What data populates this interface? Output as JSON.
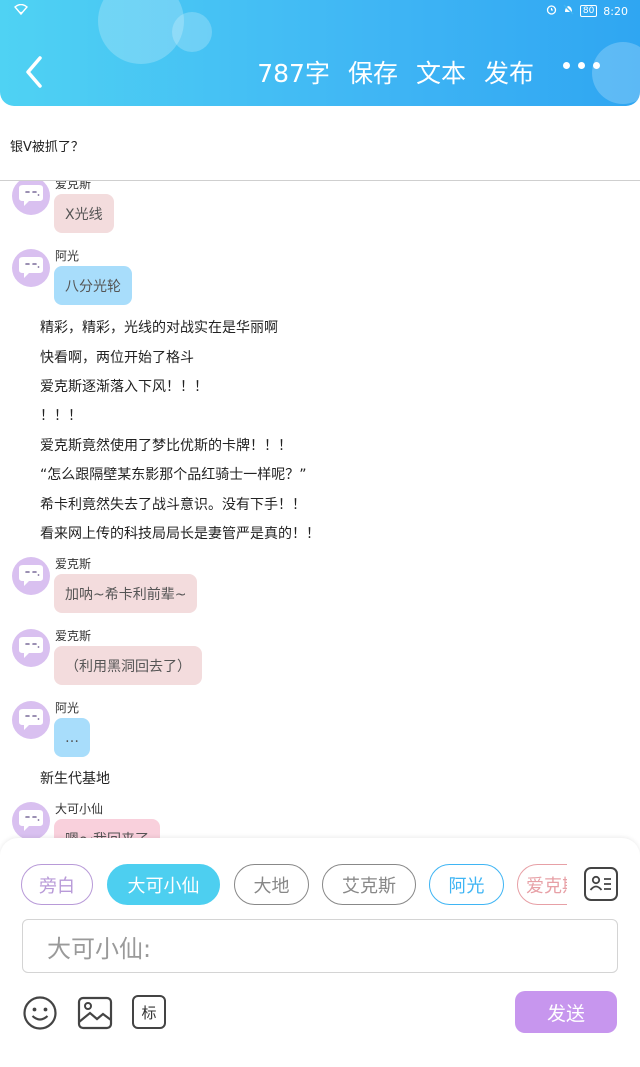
{
  "status_bar": {
    "wifi": "wifi-icon",
    "alarm": "alarm-icon",
    "mute": "mute-icon",
    "battery": "80",
    "time": "8:20"
  },
  "header": {
    "back": "back-chevron-icon",
    "word_count": "787字",
    "save": "保存",
    "text": "文本",
    "publish": "发布",
    "more": "more-dots-icon"
  },
  "title": "银V被抓了？",
  "messages": [
    {
      "type": "bubble",
      "name": "爱克斯",
      "text": "X光线",
      "color": "#f3dcdd"
    },
    {
      "type": "bubble",
      "name": "阿光",
      "text": "八分光轮",
      "color": "#a8ddfb"
    },
    {
      "type": "narration",
      "text": "精彩，精彩，光线的对战实在是华丽啊"
    },
    {
      "type": "narration",
      "text": "快看啊，两位开始了格斗"
    },
    {
      "type": "narration",
      "text": "爱克斯逐渐落入下风！！！"
    },
    {
      "type": "narration",
      "text": "！！！"
    },
    {
      "type": "narration",
      "text": "爱克斯竟然使用了梦比优斯的卡牌！！！"
    },
    {
      "type": "narration",
      "text": "“怎么跟隔壁某东影那个品红骑士一样呢？”"
    },
    {
      "type": "narration",
      "text": "希卡利竟然失去了战斗意识。没有下手！！"
    },
    {
      "type": "narration",
      "text": "看来网上传的科技局局长是妻管严是真的！！"
    },
    {
      "type": "bubble",
      "name": "爱克斯",
      "text": "加呐~希卡利前辈~",
      "color": "#f3dcdd"
    },
    {
      "type": "bubble",
      "name": "爱克斯",
      "text": "（利用黑洞回去了）",
      "color": "#f3dcdd"
    },
    {
      "type": "bubble",
      "name": "阿光",
      "text": "…",
      "color": "#a8ddfb"
    },
    {
      "type": "narration",
      "text": "新生代基地"
    },
    {
      "type": "bubble",
      "name": "大可小仙",
      "text": "嗯～我回来了",
      "color": "#f9d0dc"
    }
  ],
  "roles": [
    {
      "label": "旁白",
      "color": "#b89ad8",
      "selected": false
    },
    {
      "label": "大可小仙",
      "color": "#4dcff0",
      "selected": true
    },
    {
      "label": "大地",
      "color": "#888888",
      "selected": false
    },
    {
      "label": "艾克斯",
      "color": "#888888",
      "selected": false
    },
    {
      "label": "阿光",
      "color": "#3fb5f4",
      "selected": false
    },
    {
      "label": "爱克斯",
      "color": "#e7a0a6",
      "selected": false
    }
  ],
  "input": {
    "placeholder": "大可小仙:"
  },
  "toolbar": {
    "emoji": "emoji-icon",
    "image": "image-icon",
    "tag_label": "标",
    "contacts": "contacts-icon",
    "send": "发送"
  },
  "colors": {
    "header_start": "#4fd2f3",
    "header_end": "#2fa6f2",
    "avatar": "#d9c0f0",
    "send": "#c796ee"
  }
}
